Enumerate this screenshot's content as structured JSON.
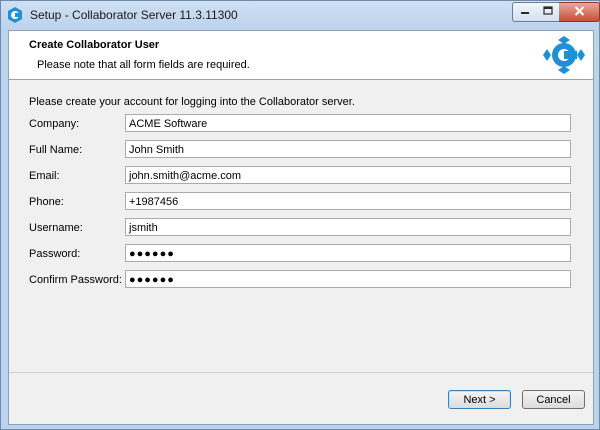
{
  "window": {
    "title": "Setup - Collaborator Server 11.3.11300"
  },
  "header": {
    "title": "Create Collaborator User",
    "subtitle": "Please note that all form fields are required."
  },
  "intro": "Please create your account for logging into the Collaborator server.",
  "form": {
    "company": {
      "label": "Company:",
      "value": "ACME Software"
    },
    "full_name": {
      "label": "Full Name:",
      "value": "John Smith"
    },
    "email": {
      "label": "Email:",
      "value": "john.smith@acme.com"
    },
    "phone": {
      "label": "Phone:",
      "value": "+1987456"
    },
    "username": {
      "label": "Username:",
      "value": "jsmith"
    },
    "password": {
      "label": "Password:",
      "value": "●●●●●●"
    },
    "confirm_password": {
      "label": "Confirm Password:",
      "value": "●●●●●●"
    }
  },
  "buttons": {
    "next": "Next >",
    "cancel": "Cancel"
  },
  "colors": {
    "brand_blue": "#1f8fd6",
    "titlebar": "#bcd3ec",
    "close_button": "#c7503a"
  },
  "icons": {
    "app": "collaborator-logo-icon",
    "header": "collaborator-logo-icon",
    "minimize": "minimize-icon",
    "maximize": "maximize-icon",
    "close": "close-icon"
  }
}
